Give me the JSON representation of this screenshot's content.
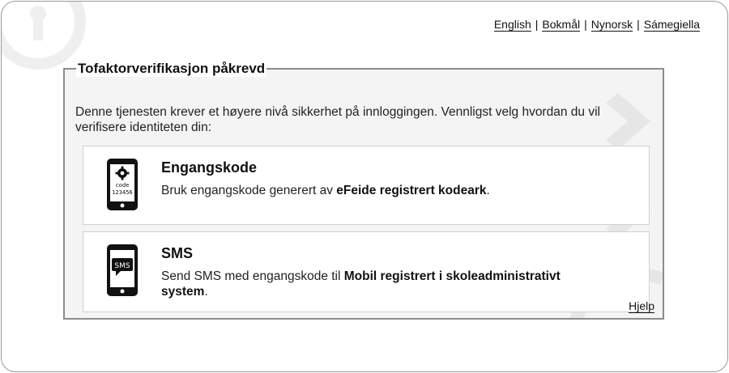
{
  "languages": [
    "English",
    "Bokmål",
    "Nynorsk",
    "Sámegiella"
  ],
  "separator": "|",
  "form": {
    "legend": "Tofaktorverifikasjon påkrevd",
    "intro": "Denne tjenesten krever et høyere nivå sikkerhet på innloggingen. Vennligst velg hvordan du vil verifisere identiteten din:",
    "help": "Hjelp"
  },
  "options": [
    {
      "title": "Engangskode",
      "desc_pre": "Bruk engangskode generert av ",
      "desc_bold": "eFeide registrert kodeark",
      "desc_post": ".",
      "icon": "phone-code-icon",
      "icon_text_1": "code",
      "icon_text_2": "123456"
    },
    {
      "title": "SMS",
      "desc_pre": "Send SMS med engangskode til ",
      "desc_bold": "Mobil registrert i skoleadministrativt system",
      "desc_post": ".",
      "icon": "phone-sms-icon",
      "icon_text_1": "SMS"
    }
  ],
  "colors": {
    "panel": "#f4f4f4",
    "border": "#8c8c8c",
    "card": "#ffffff"
  }
}
